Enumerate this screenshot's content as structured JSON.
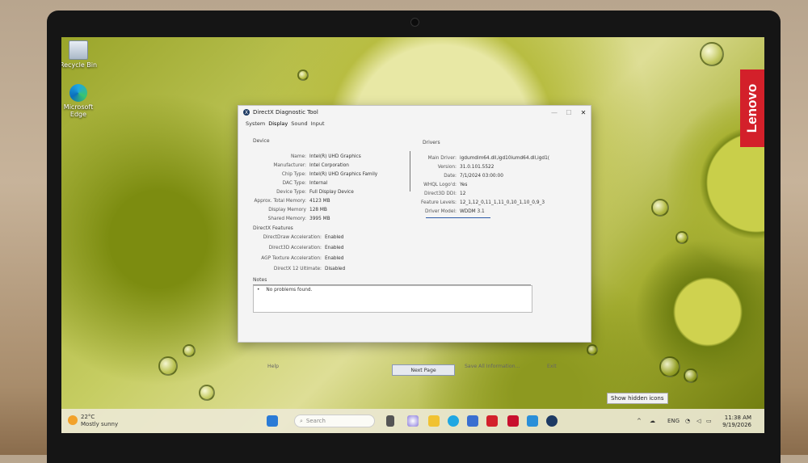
{
  "desktop": {
    "icons": [
      {
        "label": "Recycle Bin",
        "icon": "recycle-bin-icon"
      },
      {
        "label": "Microsoft Edge",
        "icon": "edge-icon"
      }
    ],
    "brand": "Lenovo"
  },
  "window": {
    "title": "DirectX Diagnostic Tool",
    "controls": {
      "minimize": "—",
      "maximize": "☐",
      "close": "✕"
    },
    "tabs": [
      "System",
      "Display",
      "Sound",
      "Input"
    ],
    "device": {
      "heading": "Device",
      "rows": [
        {
          "k": "Name:",
          "v": "Intel(R) UHD Graphics"
        },
        {
          "k": "Manufacturer:",
          "v": "Intel Corporation"
        },
        {
          "k": "Chip Type:",
          "v": "Intel(R) UHD Graphics Family"
        },
        {
          "k": "DAC Type:",
          "v": "Internal"
        },
        {
          "k": "Device Type:",
          "v": "Full Display Device"
        },
        {
          "k": "Approx. Total Memory:",
          "v": "4123 MB"
        },
        {
          "k": "Display Memory",
          "v": "128 MB"
        },
        {
          "k": "Shared Memory:",
          "v": "3995 MB"
        }
      ]
    },
    "drivers": {
      "heading": "Drivers",
      "rows": [
        {
          "k": "Main Driver:",
          "v": "igdumdim64.dll,igd10iumd64.dll,igd1("
        },
        {
          "k": "Version:",
          "v": "31.0.101.5522"
        },
        {
          "k": "Date:",
          "v": "7/1/2024 03:00:00"
        },
        {
          "k": "WHQL Logo'd:",
          "v": "Yes"
        },
        {
          "k": "Direct3D DDI:",
          "v": "12"
        },
        {
          "k": "Feature Levels:",
          "v": "12_1,12_0,11_1,11_0,10_1,10_0,9_3"
        },
        {
          "k": "Driver Model:",
          "v": "WDDM 3.1"
        }
      ]
    },
    "features": {
      "heading": "DirectX Features",
      "rows": [
        {
          "k": "DirectDraw Acceleration:",
          "v": "Enabled"
        },
        {
          "k": "Direct3D Acceleration:",
          "v": "Enabled"
        },
        {
          "k": "AGP Texture Acceleration:",
          "v": "Enabled"
        },
        {
          "k": "DirectX 12 Ultimate:",
          "v": "Disabled"
        }
      ]
    },
    "notes": {
      "heading": "Notes",
      "bullet": "•",
      "items": [
        "No problems found."
      ]
    },
    "buttons": {
      "help": "Help",
      "next": "Next Page",
      "save": "Save All Information...",
      "exit": "Exit"
    }
  },
  "tooltip": "Show hidden icons",
  "taskbar": {
    "weather_temp": "22°C",
    "weather_desc": "Mostly sunny",
    "search_placeholder": "Search",
    "language": "ENG",
    "time": "11:38 AM",
    "date": "9/19/2026",
    "tray_chevron": "^"
  }
}
